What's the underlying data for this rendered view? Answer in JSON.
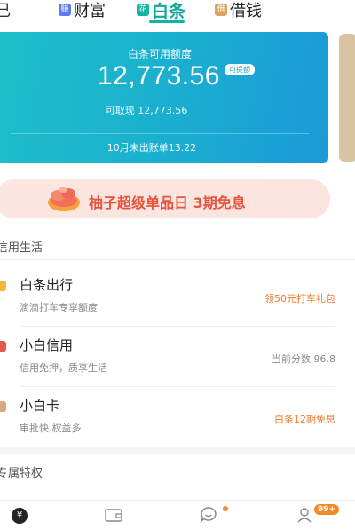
{
  "tabs": [
    {
      "label": "己",
      "badge": ""
    },
    {
      "label": "财富",
      "badge": "赚"
    },
    {
      "label": "白条",
      "badge": "花",
      "active": true
    },
    {
      "label": "借钱",
      "badge": "借"
    }
  ],
  "credit": {
    "title": "白条可用额度",
    "amount": "12,773.56",
    "chip": "可提额",
    "withdraw": "可取现 12,773.56",
    "bill": "10月未出账单13.22"
  },
  "promo": {
    "text": "柚子超级单品日 3期免息",
    "icon": "grapefruit-icon"
  },
  "sections": {
    "credit_life": "信用生活",
    "exclusive": "专属特权"
  },
  "rows": [
    {
      "title": "白条出行",
      "sub": "滴滴打车专享额度",
      "right": "领50元打车礼包",
      "icon_color": "#f4b63c"
    },
    {
      "title": "小白信用",
      "sub": "信用免押，质享生活",
      "right": "当前分数 96.8",
      "icon_color": "#e05a48"
    },
    {
      "title": "小白卡",
      "sub": "审批快 权益多",
      "right": "白条12期免息",
      "icon_color": "#d8a87a"
    }
  ],
  "nav": {
    "home_glyph": "¥",
    "user_badge": "99+"
  },
  "colors": {
    "accent": "#12b5a4",
    "orange": "#f07a2a"
  }
}
